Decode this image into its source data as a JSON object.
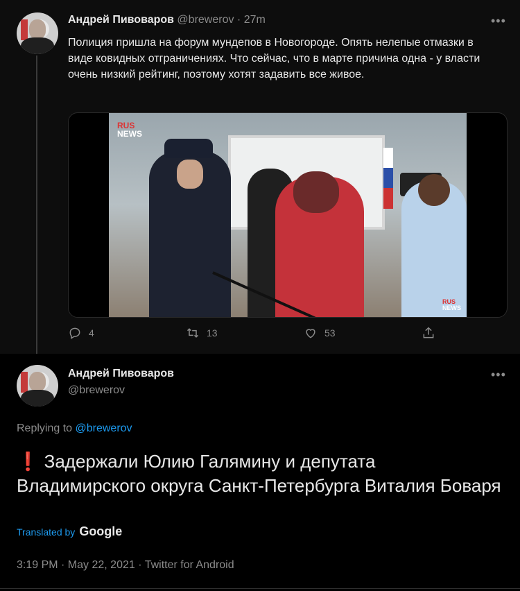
{
  "tweet1": {
    "author_name": "Андрей Пивоваров",
    "handle": "@brewerov",
    "sep": "·",
    "time": "27m",
    "text": "Полиция пришла на форум мундепов в Новогороде. Опять нелепые отмазки в виде ковидных отграничениях. Что сейчас, что в марте причина одна - у власти очень низкий рейтинг, поэтому хотят задавить все живое.",
    "more": "•••",
    "media_logo_top": "RUS",
    "media_logo_bottom": "NEWS",
    "media_logo_small_top": "RUS",
    "media_logo_small_bottom": "NEWS",
    "actions": {
      "reply_count": "4",
      "retweet_count": "13",
      "like_count": "53"
    }
  },
  "tweet2": {
    "author_name": "Андрей Пивоваров",
    "handle": "@brewerov",
    "more": "•••",
    "replying_prefix": "Replying to",
    "replying_to": "@brewerov",
    "excl": "❗",
    "text": "Задержали Юлию Галямину и депутата Владимирского округа Санкт-Петербурга Виталия Боваря",
    "translated_by": "Translated by",
    "google": "Google",
    "timestamp": "3:19 PM · May 22, 2021 · Twitter for Android"
  },
  "colors": {
    "accent": "#1d9bf0",
    "text_primary": "#e7e7e7",
    "text_secondary": "#8b8b8b",
    "background": "#000000"
  }
}
